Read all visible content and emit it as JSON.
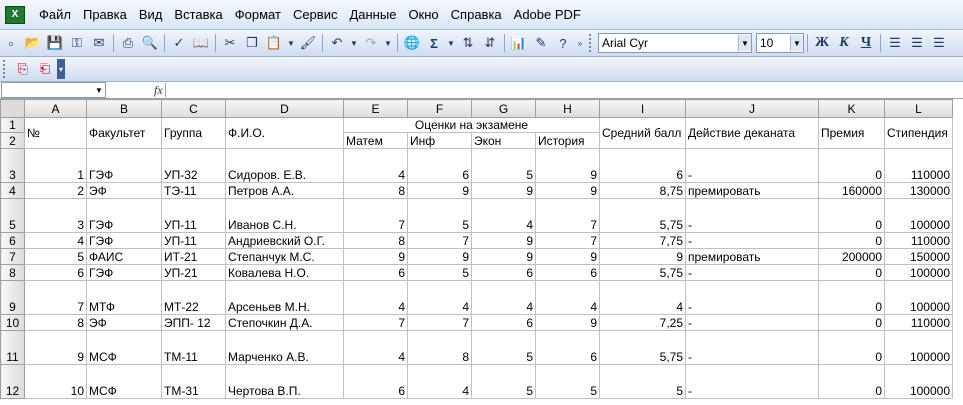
{
  "menu": [
    "Файл",
    "Правка",
    "Вид",
    "Вставка",
    "Формат",
    "Сервис",
    "Данные",
    "Окно",
    "Справка",
    "Adobe PDF"
  ],
  "toolbar": {
    "font_name": "Arial Cyr",
    "font_size": "10",
    "sigma": "Σ",
    "bold": "Ж",
    "italic": "К",
    "underline": "Ч"
  },
  "formula_bar": {
    "name_box": "",
    "fx_label": "fx",
    "content": ""
  },
  "columns": [
    "A",
    "B",
    "C",
    "D",
    "E",
    "F",
    "G",
    "H",
    "I",
    "J",
    "K",
    "L"
  ],
  "header": {
    "no": "№",
    "faculty": "Факультет",
    "group": "Группа",
    "fio": "Ф.И.О.",
    "exams": "Оценки на экзамене",
    "avg": "Средний балл",
    "action": "Действие деканата",
    "bonus": "Премия",
    "stipend": "Стипендия",
    "sub": [
      "Матем",
      "Инф",
      "Экон",
      "История"
    ]
  },
  "row_numbers": [
    "1",
    "2",
    "3",
    "4",
    "5",
    "6",
    "7",
    "8",
    "9",
    "10",
    "11",
    "12"
  ],
  "rows": [
    {
      "rn": "3",
      "no": "1",
      "fac": "ГЭФ",
      "grp": "УП-32",
      "fio": "Сидоров. Е.В.",
      "m": "4",
      "i": "6",
      "e": "5",
      "h": "9",
      "avg": "6",
      "act": "-",
      "bonus": "0",
      "st": "110000"
    },
    {
      "rn": "4",
      "no": "2",
      "fac": "ЭФ",
      "grp": "ТЭ-11",
      "fio": "Петров А.А.",
      "m": "8",
      "i": "9",
      "e": "9",
      "h": "9",
      "avg": "8,75",
      "act": "премировать",
      "bonus": "160000",
      "st": "130000"
    },
    {
      "rn": "5",
      "no": "3",
      "fac": "ГЭФ",
      "grp": "УП-11",
      "fio": "Иванов С.Н.",
      "m": "7",
      "i": "5",
      "e": "4",
      "h": "7",
      "avg": "5,75",
      "act": "-",
      "bonus": "0",
      "st": "100000"
    },
    {
      "rn": "6",
      "no": "4",
      "fac": "ГЭФ",
      "grp": "УП-11",
      "fio": "Андриевский О.Г.",
      "m": "8",
      "i": "7",
      "e": "9",
      "h": "7",
      "avg": "7,75",
      "act": "-",
      "bonus": "0",
      "st": "110000"
    },
    {
      "rn": "7",
      "no": "5",
      "fac": "ФАИС",
      "grp": "ИТ-21",
      "fio": "Степанчук М.С.",
      "m": "9",
      "i": "9",
      "e": "9",
      "h": "9",
      "avg": "9",
      "act": "премировать",
      "bonus": "200000",
      "st": "150000"
    },
    {
      "rn": "8",
      "no": "6",
      "fac": "ГЭФ",
      "grp": "УП-21",
      "fio": "Ковалева Н.О.",
      "m": "6",
      "i": "5",
      "e": "6",
      "h": "6",
      "avg": "5,75",
      "act": "-",
      "bonus": "0",
      "st": "100000"
    },
    {
      "rn": "9",
      "no": "7",
      "fac": "МТФ",
      "grp": "МТ-22",
      "fio": "Арсеньев М.Н.",
      "m": "4",
      "i": "4",
      "e": "4",
      "h": "4",
      "avg": "4",
      "act": "-",
      "bonus": "0",
      "st": "100000"
    },
    {
      "rn": "10",
      "no": "8",
      "fac": "ЭФ",
      "grp": "ЭПП- 12",
      "fio": "Степочкин Д.А.",
      "m": "7",
      "i": "7",
      "e": "6",
      "h": "9",
      "avg": "7,25",
      "act": "-",
      "bonus": "0",
      "st": "110000"
    },
    {
      "rn": "11",
      "no": "9",
      "fac": "МСФ",
      "grp": "ТМ-11",
      "fio": "Марченко А.В.",
      "m": "4",
      "i": "8",
      "e": "5",
      "h": "6",
      "avg": "5,75",
      "act": "-",
      "bonus": "0",
      "st": "100000"
    },
    {
      "rn": "12",
      "no": "10",
      "fac": "МСФ",
      "grp": "ТМ-31",
      "fio": "Чертова В.П.",
      "m": "6",
      "i": "4",
      "e": "5",
      "h": "5",
      "avg": "5",
      "act": "-",
      "bonus": "0",
      "st": "100000"
    }
  ]
}
